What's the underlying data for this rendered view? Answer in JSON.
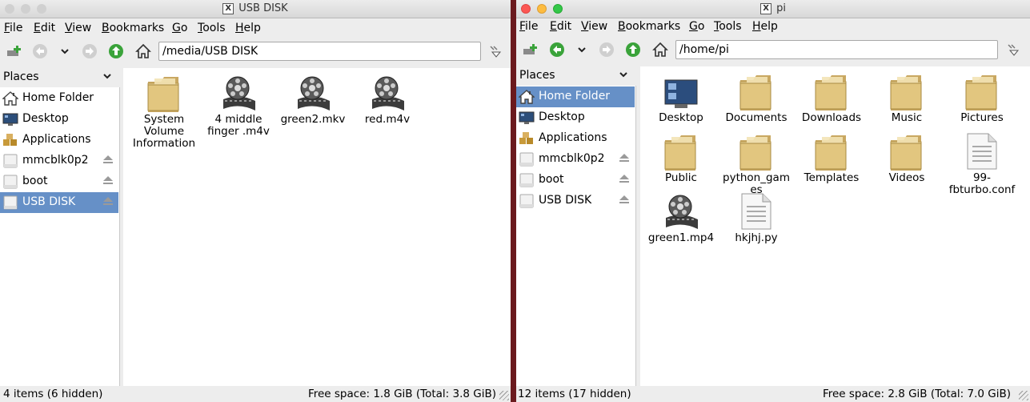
{
  "colors": {
    "selection": "#6690c7",
    "folder": "#d9bd7c",
    "desktop_bg": "#6b1a1e"
  },
  "menu": [
    "File",
    "Edit",
    "View",
    "Bookmarks",
    "Go",
    "Tools",
    "Help"
  ],
  "left": {
    "title": "USB DISK",
    "path": "/media/USB DISK",
    "places_label": "Places",
    "places": [
      {
        "label": "Home Folder",
        "icon": "home-icon"
      },
      {
        "label": "Desktop",
        "icon": "desktop-icon"
      },
      {
        "label": "Applications",
        "icon": "applications-icon"
      },
      {
        "label": "mmcblk0p2",
        "icon": "drive-icon",
        "eject": true
      },
      {
        "label": "boot",
        "icon": "drive-icon",
        "eject": true
      },
      {
        "label": "USB DISK",
        "icon": "drive-icon",
        "eject": true,
        "selected": true
      }
    ],
    "files": [
      {
        "name": "System Volume Information",
        "type": "folder"
      },
      {
        "name": "4 middle finger .m4v",
        "type": "video"
      },
      {
        "name": "green2.mkv",
        "type": "video"
      },
      {
        "name": "red.m4v",
        "type": "video"
      }
    ],
    "status_items": "4 items (6 hidden)",
    "status_space": "Free space: 1.8 GiB (Total: 3.8 GiB)"
  },
  "right": {
    "title": "pi",
    "path": "/home/pi",
    "places_label": "Places",
    "places": [
      {
        "label": "Home Folder",
        "icon": "home-icon",
        "selected": true
      },
      {
        "label": "Desktop",
        "icon": "desktop-icon"
      },
      {
        "label": "Applications",
        "icon": "applications-icon"
      },
      {
        "label": "mmcblk0p2",
        "icon": "drive-icon",
        "eject": true
      },
      {
        "label": "boot",
        "icon": "drive-icon",
        "eject": true
      },
      {
        "label": "USB DISK",
        "icon": "drive-icon",
        "eject": true
      }
    ],
    "files": [
      {
        "name": "Desktop",
        "type": "desktop"
      },
      {
        "name": "Documents",
        "type": "folder"
      },
      {
        "name": "Downloads",
        "type": "folder"
      },
      {
        "name": "Music",
        "type": "folder"
      },
      {
        "name": "Pictures",
        "type": "folder"
      },
      {
        "name": "Public",
        "type": "folder"
      },
      {
        "name": "python_games",
        "type": "folder"
      },
      {
        "name": "Templates",
        "type": "folder"
      },
      {
        "name": "Videos",
        "type": "folder"
      },
      {
        "name": "99-fbturbo.conf",
        "type": "text"
      },
      {
        "name": "green1.mp4",
        "type": "video"
      },
      {
        "name": "hkjhj.py",
        "type": "text"
      }
    ],
    "status_items": "12 items (17 hidden)",
    "status_space": "Free space: 2.8 GiB (Total: 7.0 GiB)"
  }
}
